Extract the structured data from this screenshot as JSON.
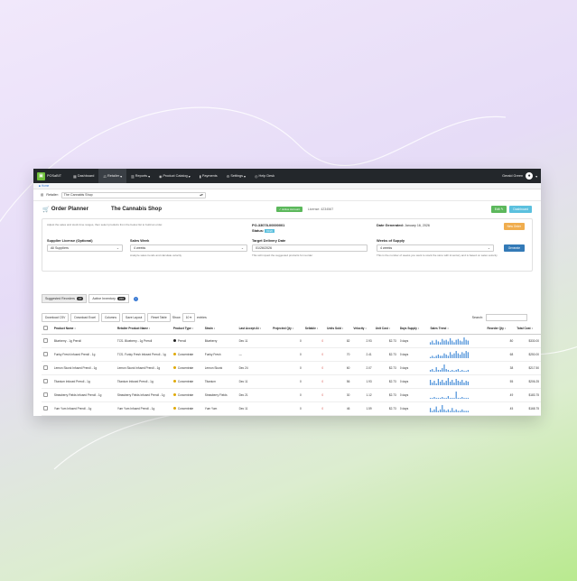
{
  "nav": {
    "brand": "POSaBIT",
    "items": [
      {
        "label": "Dashboard",
        "icon": "dashboard-icon"
      },
      {
        "label": "Retailer",
        "icon": "retailer-icon",
        "active": true
      },
      {
        "label": "Reports",
        "icon": "chart-icon"
      },
      {
        "label": "Product Catalog",
        "icon": "catalog-icon"
      },
      {
        "label": "Payments",
        "icon": "payments-icon"
      },
      {
        "label": "Settings",
        "icon": "settings-icon"
      },
      {
        "label": "Help Desk",
        "icon": "help-icon"
      }
    ],
    "user": "Gerald Green"
  },
  "breadcrumb": "Home",
  "retailer": {
    "label": "Retailer:",
    "value": "The Cannabis Shop"
  },
  "header": {
    "title": "Order Planner",
    "shop": "The Cannabis Shop",
    "status_badge": "✓ Active Account",
    "license": "License: 4234567",
    "edit_label": "Edit",
    "dashboard_label": "Dashboard"
  },
  "panel": {
    "intro": "Adjust the sales and stock time ranges, then select products from the below list to build an order.",
    "po_number": "PO-33078-00000001",
    "status_label": "Status:",
    "status_value": "Draft",
    "date_generated_label": "Date Generated:",
    "date_generated_value": "January 16, 2026",
    "new_order_label": "New Order",
    "supplier_label": "Supplier License (Optional)",
    "supplier_value": "All Suppliers",
    "sales_week_label": "Sales Week",
    "sales_week_value": "4 weeks",
    "sales_week_hint": "Analyze sales trends and calculate velocity",
    "target_label": "Target Delivery Date",
    "target_value": "01/26/2026",
    "target_hint": "This will impact the suggested products for reorder",
    "weeks_label": "Weeks of Supply",
    "weeks_value": "4 weeks",
    "weeks_hint": "This is the number of weeks you want to stock the store with inventory and is based on sales velocity",
    "generate_label": "Generate"
  },
  "tabs": [
    {
      "label": "Suggested Reorders",
      "count": "37"
    },
    {
      "label": "Active Inventory",
      "count": "226"
    }
  ],
  "toolbar": {
    "buttons": [
      "Download CSV",
      "Download Excel",
      "Columns",
      "Save Layout",
      "Reset Table"
    ],
    "show_label": "Show",
    "show_value": "10",
    "entries_label": "entries",
    "search_label": "Search:"
  },
  "table": {
    "columns": [
      "Product Name",
      "Retailer Product Name",
      "Product Type",
      "Strain",
      "Last Accept At",
      "Projected Qty",
      "Sellable",
      "Units Sold",
      "Velocity",
      "Unit Cost",
      "Days Supply",
      "Sales Trend",
      "Reorder Qty",
      "Total Cost"
    ],
    "rows": [
      {
        "product": "Blueberry - 1g Preroll",
        "retailer": "TCS- Blueberry - 1g Preroll",
        "type": "Preroll",
        "type_color": "#222222",
        "strain": "Blueberry",
        "last": "Dec 11",
        "proj": "0",
        "sell": "0",
        "units": "82",
        "vel": "2.93",
        "cost": "$2.73",
        "days": "0 days",
        "trend": [
          3,
          5,
          2,
          6,
          4,
          3,
          7,
          5,
          6,
          4,
          8,
          5,
          3,
          6,
          7,
          5,
          4,
          9,
          6,
          5
        ],
        "reorder": "80",
        "total": "$330.00"
      },
      {
        "product": "Funky Fresh Infused Preroll - 1g",
        "retailer": "TCS- Funky Fresh Infused Preroll - 1g",
        "type": "Concentrate",
        "type_color": "#e0a800",
        "strain": "Funky Fresh",
        "last": "—",
        "proj": "0",
        "sell": "0",
        "units": "70",
        "vel": "2.41",
        "cost": "$2.73",
        "days": "0 days",
        "trend": [
          1,
          2,
          1,
          2,
          3,
          2,
          2,
          4,
          3,
          2,
          5,
          3,
          4,
          6,
          4,
          3,
          5,
          4,
          6,
          5
        ],
        "reorder": "68",
        "total": "$250.00"
      },
      {
        "product": "Lemon Skunk Infused Preroll - 1g",
        "retailer": "Lemon Skunk Infused Preroll - 1g",
        "type": "Concentrate",
        "type_color": "#e0a800",
        "strain": "Lemon Skunk",
        "last": "Dec 24",
        "proj": "0",
        "sell": "0",
        "units": "60",
        "vel": "2.07",
        "cost": "$2.73",
        "days": "0 days",
        "trend": [
          2,
          3,
          1,
          5,
          2,
          2,
          4,
          8,
          3,
          2,
          1,
          2,
          1,
          2,
          3,
          1,
          2,
          1,
          1,
          2
        ],
        "reorder": "38",
        "total": "$217.50"
      },
      {
        "product": "Titanium Infused Preroll - 1g",
        "retailer": "Titanium Infused Preroll - 1g",
        "type": "Concentrate",
        "type_color": "#e0a800",
        "strain": "Titanium",
        "last": "Dec 11",
        "proj": "0",
        "sell": "0",
        "units": "56",
        "vel": "1.93",
        "cost": "$2.73",
        "days": "0 days",
        "trend": [
          6,
          3,
          5,
          2,
          7,
          4,
          6,
          3,
          5,
          8,
          4,
          6,
          3,
          7,
          5,
          4,
          6,
          3,
          5,
          4
        ],
        "reorder": "55",
        "total": "$206.25"
      },
      {
        "product": "Strawberry Fields Infused Preroll - 1g",
        "retailer": "Strawberry Fields Infused Preroll - 1g",
        "type": "Concentrate",
        "type_color": "#e0a800",
        "strain": "Strawberry Fields",
        "last": "Dec 21",
        "proj": "0",
        "sell": "0",
        "units": "30",
        "vel": "1.12",
        "cost": "$2.73",
        "days": "0 days",
        "trend": [
          1,
          1,
          2,
          1,
          1,
          1,
          2,
          1,
          1,
          3,
          1,
          1,
          1,
          8,
          1,
          1,
          2,
          1,
          1,
          1
        ],
        "reorder": "49",
        "total": "$183.75"
      },
      {
        "product": "Yum Yum Infused Preroll - 1g",
        "retailer": "Yum Yum Infused Preroll - 1g",
        "type": "Concentrate",
        "type_color": "#e0a800",
        "strain": "Yum Yum",
        "last": "Dec 11",
        "proj": "0",
        "sell": "0",
        "units": "46",
        "vel": "1.59",
        "cost": "$2.73",
        "days": "0 days",
        "trend": [
          3,
          1,
          2,
          4,
          1,
          2,
          5,
          2,
          1,
          2,
          1,
          3,
          1,
          2,
          1,
          1,
          2,
          1,
          1,
          1
        ],
        "reorder": "45",
        "total": "$168.75"
      }
    ]
  },
  "colors": {
    "accent_green": "#5cb85c",
    "accent_blue": "#5bc0de",
    "warning": "#f0ad4e",
    "primary": "#337ab7",
    "nav_bg": "#23272b",
    "spark": "#4a90d9"
  }
}
